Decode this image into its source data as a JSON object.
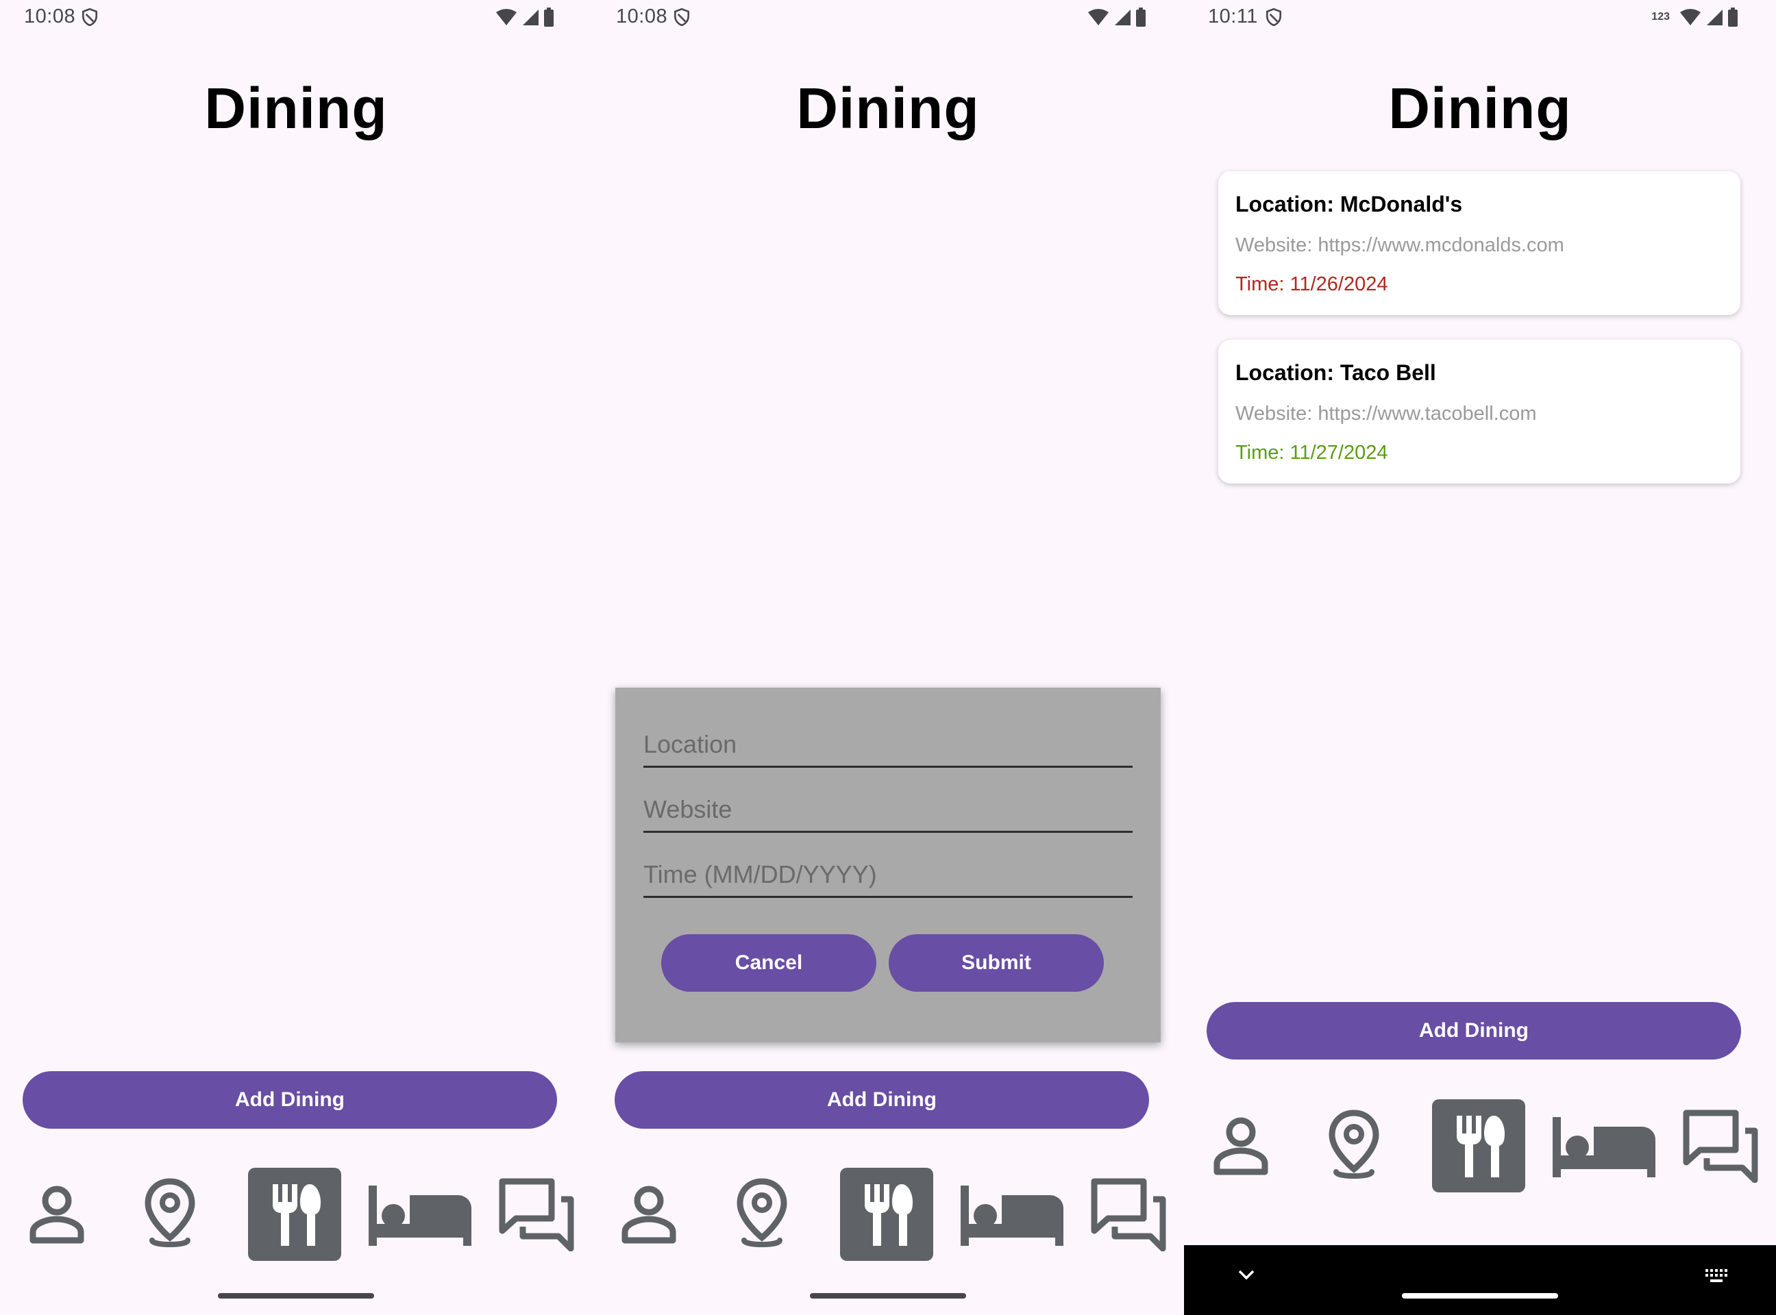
{
  "screens": [
    {
      "status": {
        "time": "10:08",
        "extra": ""
      },
      "title": "Dining",
      "add_button": "Add Dining"
    },
    {
      "status": {
        "time": "10:08",
        "extra": ""
      },
      "title": "Dining",
      "dialog": {
        "location_placeholder": "Location",
        "website_placeholder": "Website",
        "time_placeholder": "Time (MM/DD/YYYY)",
        "cancel": "Cancel",
        "submit": "Submit"
      },
      "add_button": "Add Dining"
    },
    {
      "status": {
        "time": "10:11",
        "extra": "123"
      },
      "title": "Dining",
      "cards": [
        {
          "location": "Location: McDonald's",
          "website": "Website: https://www.mcdonalds.com",
          "time": "Time: 11/26/2024",
          "time_color": "#b3261e"
        },
        {
          "location": "Location: Taco Bell",
          "website": "Website: https://www.tacobell.com",
          "time": "Time: 11/27/2024",
          "time_color": "#5c9c12"
        }
      ],
      "add_button": "Add Dining"
    }
  ],
  "nav_icons": [
    "person-icon",
    "location-pin-icon",
    "dining-icon",
    "hotel-bed-icon",
    "chat-icon"
  ],
  "colors": {
    "accent": "#684ea4",
    "background": "#fdf7fd",
    "icon": "#5f6368",
    "dialog": "#a9a9a9"
  }
}
